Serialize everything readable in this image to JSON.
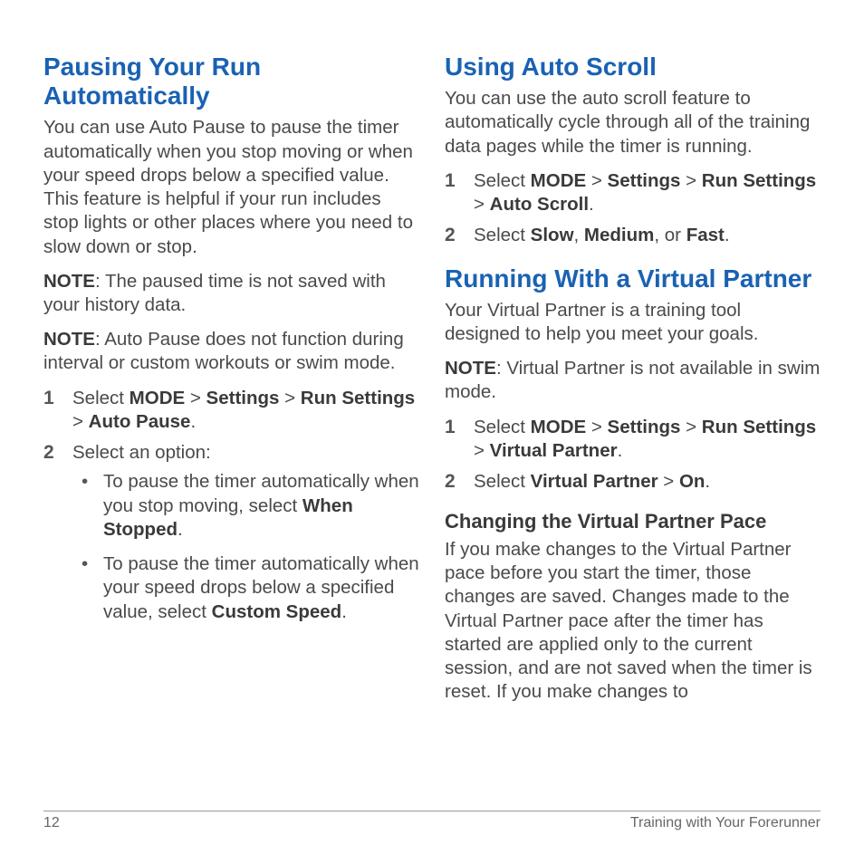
{
  "left": {
    "h1": "Pausing Your Run Automatically",
    "p1": "You can use Auto Pause to pause the timer automatically when you stop moving or when your speed drops below a specified value. This feature is helpful if your run includes stop lights or other places where you need to slow down or stop.",
    "note1_label": "NOTE",
    "note1_text": ": The paused time is not saved with your history data.",
    "note2_label": "NOTE",
    "note2_text": ": Auto Pause does not function during interval or custom workouts or swim mode.",
    "step1_pre": "Select ",
    "step1_m1": "MODE",
    "step1_s1": " > ",
    "step1_m2": "Settings",
    "step1_s2": " > ",
    "step1_m3": "Run Settings",
    "step1_s3": " > ",
    "step1_m4": "Auto Pause",
    "step1_end": ".",
    "step2": "Select an option:",
    "b1_pre": "To pause the timer automatically when you stop moving, select ",
    "b1_bold": "When Stopped",
    "b1_end": ".",
    "b2_pre": "To pause the timer automatically when your speed drops below a specified value, select ",
    "b2_bold": "Custom Speed",
    "b2_end": "."
  },
  "right": {
    "h1": "Using Auto Scroll",
    "p1": "You can use the auto scroll feature to automatically cycle through all of the training data pages while the timer is running.",
    "a_step1_pre": "Select ",
    "a_step1_m1": "MODE",
    "a_step1_s1": " > ",
    "a_step1_m2": "Settings",
    "a_step1_s2": " > ",
    "a_step1_m3": "Run Settings",
    "a_step1_s3": " > ",
    "a_step1_m4": "Auto Scroll",
    "a_step1_end": ".",
    "a_step2_pre": "Select ",
    "a_step2_b1": "Slow",
    "a_step2_s1": ", ",
    "a_step2_b2": "Medium",
    "a_step2_s2": ", or ",
    "a_step2_b3": "Fast",
    "a_step2_end": ".",
    "h2": "Running With a Virtual Partner",
    "p2": "Your Virtual Partner is a training tool designed to help you meet your goals.",
    "note_label": "NOTE",
    "note_text": ": Virtual Partner is not available in swim mode.",
    "v_step1_pre": "Select ",
    "v_step1_m1": "MODE",
    "v_step1_s1": " > ",
    "v_step1_m2": "Settings",
    "v_step1_s2": " > ",
    "v_step1_m3": "Run Settings",
    "v_step1_s3": " > ",
    "v_step1_m4": "Virtual Partner",
    "v_step1_end": ".",
    "v_step2_pre": "Select ",
    "v_step2_b1": "Virtual Partner",
    "v_step2_s1": " > ",
    "v_step2_b2": "On",
    "v_step2_end": ".",
    "h3": "Changing the Virtual Partner Pace",
    "p3": "If you make changes to the Virtual Partner pace before you start the timer, those changes are saved. Changes made to the Virtual Partner pace after the timer has started are applied only to the current session, and are not saved when the timer is reset. If you make changes to"
  },
  "footer": {
    "page": "12",
    "section": "Training with Your Forerunner"
  }
}
